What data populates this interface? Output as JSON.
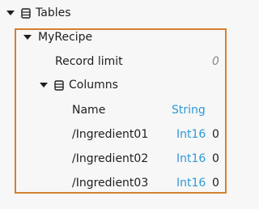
{
  "tree": {
    "root": {
      "label": "Tables",
      "icon": "table-icon"
    },
    "recipe": {
      "label": "MyRecipe",
      "record_limit": {
        "label": "Record limit",
        "value": "0"
      },
      "columns": {
        "label": "Columns",
        "icon": "table-icon",
        "items": [
          {
            "name": "Name",
            "type": "String",
            "value": ""
          },
          {
            "name": "/Ingredient01",
            "type": "Int16",
            "value": "0"
          },
          {
            "name": "/Ingredient02",
            "type": "Int16",
            "value": "0"
          },
          {
            "name": "/Ingredient03",
            "type": "Int16",
            "value": "0"
          }
        ]
      }
    }
  },
  "colors": {
    "selection_border": "#d4812f",
    "type_text": "#2d9ad6",
    "muted_value": "#8a8a8a"
  }
}
